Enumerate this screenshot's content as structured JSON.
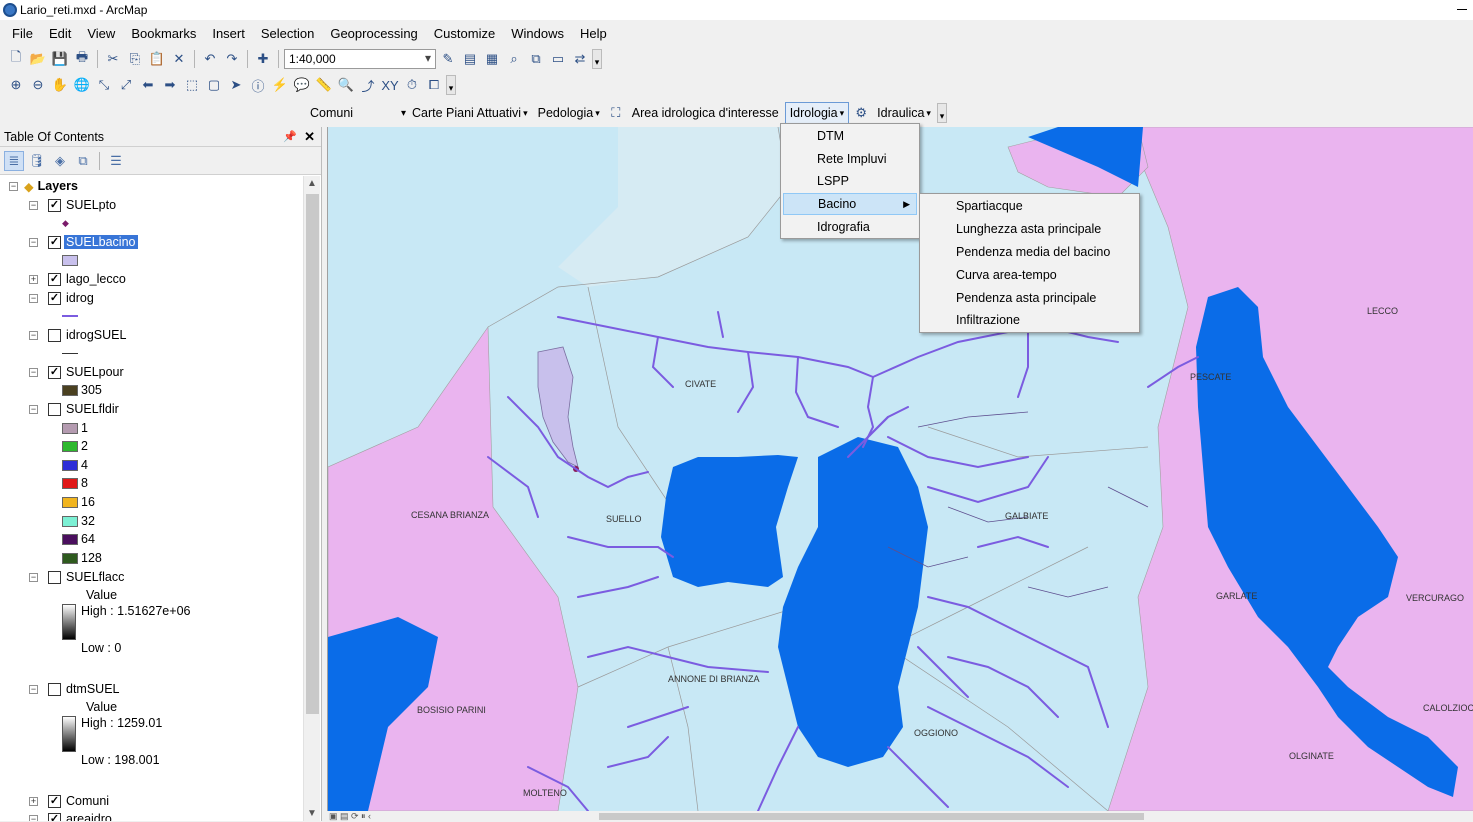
{
  "window": {
    "title": "Lario_reti.mxd - ArcMap"
  },
  "menu": [
    "File",
    "Edit",
    "View",
    "Bookmarks",
    "Insert",
    "Selection",
    "Geoprocessing",
    "Customize",
    "Windows",
    "Help"
  ],
  "toolbar": {
    "scale": "1:40,000"
  },
  "custom_toolbar": {
    "comuni": "Comuni",
    "carte": "Carte Piani Attuativi",
    "pedologia": "Pedologia",
    "area": "Area idrologica d'interesse",
    "idrologia": "Idrologia",
    "idraulica": "Idraulica"
  },
  "idrologia_menu": {
    "items": [
      "DTM",
      "Rete Impluvi",
      "LSPP",
      "Bacino",
      "Idrografia"
    ],
    "highlighted": "Bacino"
  },
  "bacino_submenu": {
    "items": [
      "Spartiacque",
      "Lunghezza asta principale",
      "Pendenza media del bacino",
      "Curva area-tempo",
      "Pendenza asta principale",
      "Infiltrazione"
    ]
  },
  "toc": {
    "title": "Table Of Contents",
    "root": "Layers",
    "layers": [
      {
        "name": "SUELpto",
        "checked": true
      },
      {
        "name": "SUELbacino",
        "checked": true,
        "selected": true,
        "color": "#c8c0ec"
      },
      {
        "name": "lago_lecco",
        "checked": true
      },
      {
        "name": "idrog",
        "checked": true,
        "color": "#7b5ce0"
      },
      {
        "name": "idrogSUEL",
        "checked": false
      },
      {
        "name": "SUELpour",
        "checked": true
      },
      {
        "name": "SUELfldir",
        "checked": false
      },
      {
        "name": "SUELflacc",
        "checked": false
      },
      {
        "name": "dtmSUEL",
        "checked": false
      },
      {
        "name": "Comuni",
        "checked": true
      },
      {
        "name": "areaidro",
        "checked": true
      }
    ],
    "suelpour_value": "305",
    "fldir_values": [
      {
        "label": "1",
        "color": "#b49bb0"
      },
      {
        "label": "2",
        "color": "#2db82d"
      },
      {
        "label": "4",
        "color": "#2e2ed8"
      },
      {
        "label": "8",
        "color": "#e01818"
      },
      {
        "label": "16",
        "color": "#f0b41e"
      },
      {
        "label": "32",
        "color": "#7cf0d4"
      },
      {
        "label": "64",
        "color": "#4a0f5e"
      },
      {
        "label": "128",
        "color": "#2e5a1e"
      }
    ],
    "flacc": {
      "value": "Value",
      "high": "High : 1.51627e+06",
      "low": "Low : 0"
    },
    "dtm": {
      "value": "Value",
      "high": "High : 1259.01",
      "low": "Low : 198.001"
    }
  },
  "map_labels": [
    "CIVATE",
    "CESANA BRIANZA",
    "SUELLO",
    "GALBIATE",
    "ANNONE DI BRIANZA",
    "BOSISIO PARINI",
    "OGGIONO",
    "MOLTENO",
    "LECCO",
    "PESCATE",
    "GARLATE",
    "VERCURAGO",
    "CALOLZIOC",
    "OLGINATE"
  ],
  "colors": {
    "lake": "#0a6ce8",
    "basin": "#c8e8f5",
    "municipality": "#eab4ef",
    "river": "#7b5ce0"
  }
}
